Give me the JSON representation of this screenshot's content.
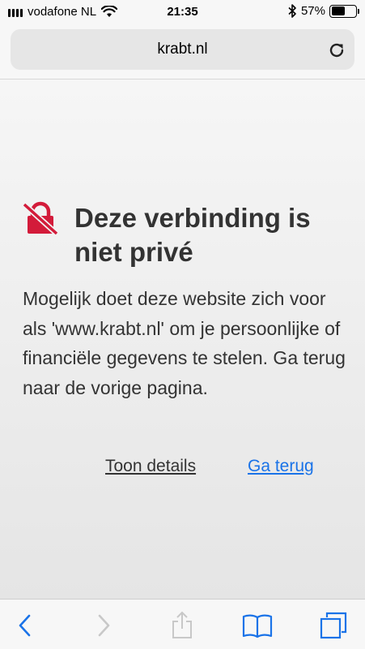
{
  "status": {
    "carrier": "vodafone NL",
    "time": "21:35",
    "battery": "57%",
    "battery_level": 0.57
  },
  "address": {
    "url": "krabt.nl"
  },
  "error": {
    "title": "Deze verbinding is niet privé",
    "message": "Mogelijk doet deze website zich voor als 'www.krabt.nl' om je persoonlijke of financiële gegevens te stelen. Ga terug naar de vorige pagina.",
    "details_label": "Toon details",
    "back_label": "Ga terug"
  },
  "colors": {
    "accent": "#1a73e8",
    "warning": "#d31b3a"
  },
  "toolbar": {
    "icons": [
      "back-icon",
      "forward-icon",
      "share-icon",
      "bookmarks-icon",
      "tabs-icon"
    ]
  }
}
